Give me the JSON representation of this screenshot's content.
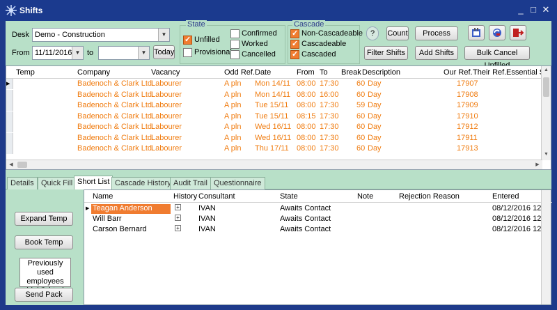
{
  "window": {
    "title": "Shifts",
    "controls": [
      "_",
      "□",
      "✕"
    ]
  },
  "filters": {
    "desk_label": "Desk",
    "desk_value": "Demo - Construction",
    "from_label": "From",
    "from_value": "11/11/2016",
    "to_label": "to",
    "to_value": "",
    "today_label": "Today"
  },
  "state": {
    "title": "State",
    "unfilled": "Unfilled",
    "provisional": "Provisional",
    "confirmed": "Confirmed",
    "worked": "Worked",
    "cancelled": "Cancelled"
  },
  "cascade": {
    "title": "Cascade",
    "non_cascadeable": "Non-Cascadeable",
    "cascadeable": "Cascadeable",
    "cascaded": "Cascaded"
  },
  "toolbar": {
    "help": "?",
    "count": "Count",
    "process": "Process",
    "filter_shifts": "Filter Shifts",
    "add_shifts": "Add Shifts",
    "bulk_cancel": "Bulk Cancel Unfilled"
  },
  "grid": {
    "headers": [
      "Temp",
      "Company",
      "Vacancy",
      "Odd Ref.",
      "Date",
      "From",
      "To",
      "Break",
      "Description",
      "Our Ref.",
      "Their Ref.",
      "Essential S"
    ],
    "rows": [
      {
        "company": "Badenoch & Clark Ltd.",
        "vacancy": "Labourer",
        "odd": "A pln",
        "date": "Mon 14/11",
        "from": "08:00",
        "to": "17:30",
        "break": "60",
        "desc": "Day",
        "ref": "17907"
      },
      {
        "company": "Badenoch & Clark Ltd.",
        "vacancy": "Labourer",
        "odd": "A pln",
        "date": "Mon 14/11",
        "from": "08:00",
        "to": "16:00",
        "break": "60",
        "desc": "Day",
        "ref": "17908"
      },
      {
        "company": "Badenoch & Clark Ltd.",
        "vacancy": "Labourer",
        "odd": "A pln",
        "date": "Tue 15/11",
        "from": "08:00",
        "to": "17:30",
        "break": "59",
        "desc": "Day",
        "ref": "17909"
      },
      {
        "company": "Badenoch & Clark Ltd.",
        "vacancy": "Labourer",
        "odd": "A pln",
        "date": "Tue 15/11",
        "from": "08:15",
        "to": "17:30",
        "break": "60",
        "desc": "Day",
        "ref": "17910"
      },
      {
        "company": "Badenoch & Clark Ltd.",
        "vacancy": "Labourer",
        "odd": "A pln",
        "date": "Wed 16/11",
        "from": "08:00",
        "to": "17:30",
        "break": "60",
        "desc": "Day",
        "ref": "17912"
      },
      {
        "company": "Badenoch & Clark Ltd.",
        "vacancy": "Labourer",
        "odd": "A pln",
        "date": "Wed 16/11",
        "from": "08:00",
        "to": "17:30",
        "break": "60",
        "desc": "Day",
        "ref": "17911"
      },
      {
        "company": "Badenoch & Clark Ltd.",
        "vacancy": "Labourer",
        "odd": "A pln",
        "date": "Thu 17/11",
        "from": "08:00",
        "to": "17:30",
        "break": "60",
        "desc": "Day",
        "ref": "17913"
      }
    ]
  },
  "tabs": [
    "Details",
    "Quick Fill",
    "Short List",
    "Cascade History",
    "Audit Trail",
    "Questionnaire"
  ],
  "actions": {
    "expand_temp": "Expand Temp",
    "book_temp": "Book Temp",
    "note": "Previously used employees highlighted",
    "send_pack": "Send Pack"
  },
  "shortlist": {
    "headers": [
      "Name",
      "History",
      "Consultant",
      "State",
      "Note",
      "Rejection Reason",
      "Entered"
    ],
    "rows": [
      {
        "name": "Teagan Anderson",
        "consultant": "IVAN",
        "state": "Awaits Contact",
        "entered": "08/12/2016 12"
      },
      {
        "name": "Will Barr",
        "consultant": "IVAN",
        "state": "Awaits Contact",
        "entered": "08/12/2016 12"
      },
      {
        "name": "Carson Bernard",
        "consultant": "IVAN",
        "state": "Awaits Contact",
        "entered": "08/12/2016 12"
      }
    ]
  },
  "colors": {
    "title_bg": "#1b3a8e",
    "panel_bg": "#b8e0c8",
    "row_text": "#f07c10",
    "highlight": "#f07c30"
  }
}
